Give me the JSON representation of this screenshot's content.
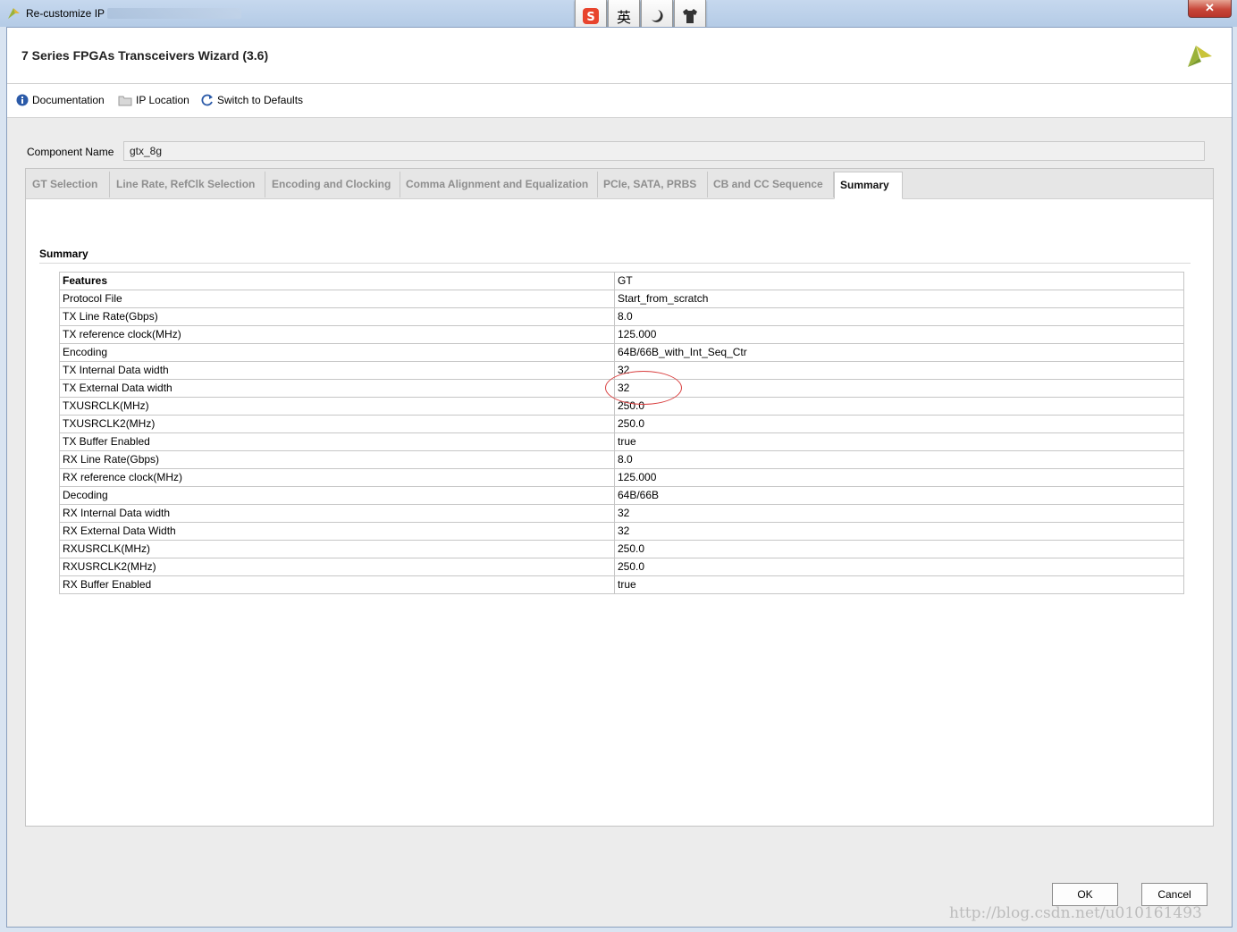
{
  "window": {
    "title": "Re-customize IP",
    "close_glyph": "✕"
  },
  "ime": {
    "buttons": [
      {
        "icon": "sogou-s-icon",
        "label": ""
      },
      {
        "icon": "english-mode-icon",
        "label": "英"
      },
      {
        "icon": "moon-icon",
        "label": ""
      },
      {
        "icon": "shirt-icon",
        "label": ""
      }
    ]
  },
  "header": {
    "title": "7 Series FPGAs Transceivers Wizard (3.6)"
  },
  "toolbar": {
    "documentation": "Documentation",
    "ip_location": "IP Location",
    "switch_defaults": "Switch to Defaults"
  },
  "component": {
    "label": "Component Name",
    "value": "gtx_8g"
  },
  "tabs": [
    {
      "label": "GT Selection",
      "active": false
    },
    {
      "label": "Line Rate, RefClk Selection",
      "active": false
    },
    {
      "label": "Encoding and Clocking",
      "active": false
    },
    {
      "label": "Comma Alignment and Equalization",
      "active": false
    },
    {
      "label": "PCIe, SATA, PRBS",
      "active": false
    },
    {
      "label": "CB and CC Sequence",
      "active": false
    },
    {
      "label": "Summary",
      "active": true
    }
  ],
  "summary": {
    "heading": "Summary",
    "rows": [
      {
        "feature": "Features",
        "value": "GT"
      },
      {
        "feature": "Protocol File",
        "value": "Start_from_scratch"
      },
      {
        "feature": "TX Line Rate(Gbps)",
        "value": "8.0"
      },
      {
        "feature": "TX reference clock(MHz)",
        "value": "125.000"
      },
      {
        "feature": "Encoding",
        "value": "64B/66B_with_Int_Seq_Ctr"
      },
      {
        "feature": "TX Internal Data width",
        "value": "32"
      },
      {
        "feature": "TX External Data width",
        "value": "32"
      },
      {
        "feature": "TXUSRCLK(MHz)",
        "value": "250.0"
      },
      {
        "feature": "TXUSRCLK2(MHz)",
        "value": "250.0"
      },
      {
        "feature": "TX Buffer Enabled",
        "value": "true"
      },
      {
        "feature": "RX Line Rate(Gbps)",
        "value": "8.0"
      },
      {
        "feature": "RX reference clock(MHz)",
        "value": "125.000"
      },
      {
        "feature": "Decoding",
        "value": "64B/66B"
      },
      {
        "feature": "RX Internal Data width",
        "value": "32"
      },
      {
        "feature": "RX External Data Width",
        "value": "32"
      },
      {
        "feature": "RXUSRCLK(MHz)",
        "value": "250.0"
      },
      {
        "feature": "RXUSRCLK2(MHz)",
        "value": "250.0"
      },
      {
        "feature": "RX Buffer Enabled",
        "value": "true"
      }
    ]
  },
  "buttons": {
    "ok": "OK",
    "cancel": "Cancel"
  },
  "watermark": "http://blog.csdn.net/u010161493",
  "colors": {
    "circle_annotation": "#d94040",
    "info_icon": "#2b5aa8"
  }
}
